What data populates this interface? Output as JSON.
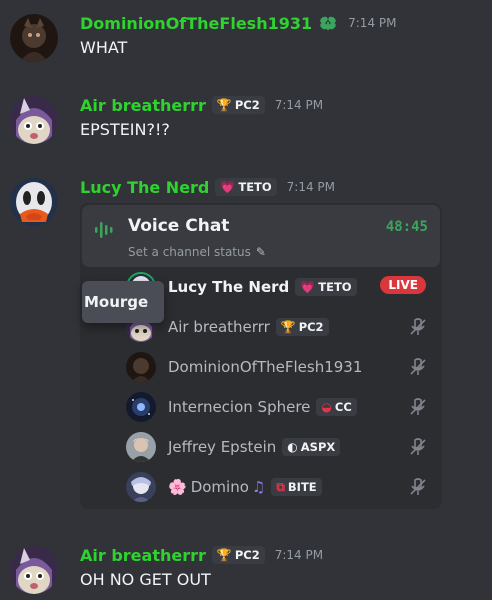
{
  "messages": [
    {
      "username": "DominionOfTheFlesh1931",
      "badge_icon": "leaf-icon",
      "badge_color": "#3ba55d",
      "time": "7:14 PM",
      "text": "WHAT"
    },
    {
      "username": "Air breatherrr",
      "tag_icon": "trophy-icon",
      "tag": "PC2",
      "time": "7:14 PM",
      "text": "EPSTEIN?!?"
    },
    {
      "username": "Lucy The Nerd",
      "tag_icon": "heart-icon",
      "tag": "TETO",
      "time": "7:14 PM"
    },
    {
      "username": "Air breatherrr",
      "tag_icon": "trophy-icon",
      "tag": "PC2",
      "time": "7:14 PM",
      "text": "OH NO GET OUT"
    }
  ],
  "voice_chat": {
    "title": "Voice Chat",
    "timer": "48:45",
    "status_placeholder": "Set a channel status",
    "live_label": "LIVE",
    "tooltip": "Mourge",
    "members": [
      {
        "name": "Lucy The Nerd",
        "tag_icon": "heart-icon",
        "tag": "TETO",
        "speaking": true,
        "live": true
      },
      {
        "name": "Air breatherrr",
        "tag_icon": "trophy-icon",
        "tag": "PC2",
        "muted": true
      },
      {
        "name": "DominionOfTheFlesh1931",
        "muted": true
      },
      {
        "name": "Internecion Sphere",
        "tag_icon": "red-ring-icon",
        "tag": "CC",
        "muted": true
      },
      {
        "name": "Jeffrey Epstein",
        "tag_icon": "moon-icon",
        "tag": "ASPX",
        "muted": true
      },
      {
        "name": "Domino",
        "prefix_icon": "cherry-blossom-icon",
        "suffix_icon": "music-notes-icon",
        "tag_icon": "robot-icon",
        "tag": "BITE",
        "muted": true
      }
    ]
  },
  "colors": {
    "background": "#313338",
    "username": "#2ed42e",
    "timer": "#3ba55d",
    "live": "#da373c",
    "speaking_ring": "#23a55a"
  }
}
